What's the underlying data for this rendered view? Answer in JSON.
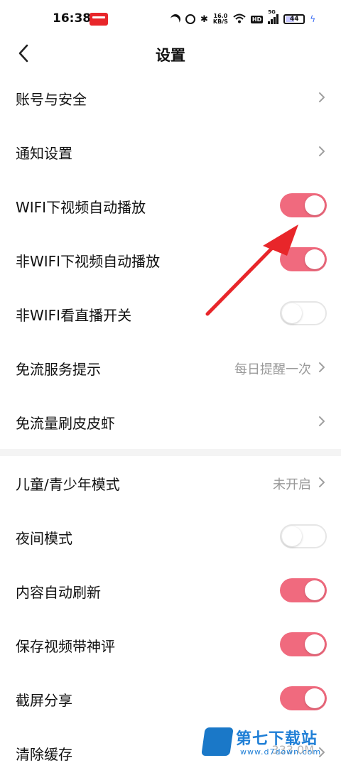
{
  "status_bar": {
    "time": "16:38",
    "net_speed_value": "16.0",
    "net_speed_unit": "KB/S",
    "hd_label": "HD",
    "signal_label": "5G",
    "battery_level": "44"
  },
  "header": {
    "title": "设置"
  },
  "colors": {
    "toggle_on": "#f06a7e",
    "arrow": "#e8262a",
    "watermark": "#1f7fd6"
  },
  "settings": {
    "group1": [
      {
        "label": "账号与安全",
        "type": "link"
      },
      {
        "label": "通知设置",
        "type": "link"
      },
      {
        "label": "WIFI下视频自动播放",
        "type": "toggle",
        "on": true
      },
      {
        "label": "非WIFI下视频自动播放",
        "type": "toggle",
        "on": true
      },
      {
        "label": "非WIFI看直播开关",
        "type": "toggle",
        "on": false
      },
      {
        "label": "免流服务提示",
        "type": "link",
        "value": "每日提醒一次"
      },
      {
        "label": "免流量刷皮皮虾",
        "type": "link"
      }
    ],
    "group2": [
      {
        "label": "儿童/青少年模式",
        "type": "link",
        "value": "未开启"
      },
      {
        "label": "夜间模式",
        "type": "toggle",
        "on": false
      },
      {
        "label": "内容自动刷新",
        "type": "toggle",
        "on": true
      },
      {
        "label": "保存视频带神评",
        "type": "toggle",
        "on": true
      },
      {
        "label": "截屏分享",
        "type": "toggle",
        "on": true
      },
      {
        "label": "清除缓存",
        "type": "link"
      }
    ]
  },
  "cache_size": "333.0M",
  "watermark": {
    "title": "第七下载站",
    "url": "www.d7down.com"
  }
}
